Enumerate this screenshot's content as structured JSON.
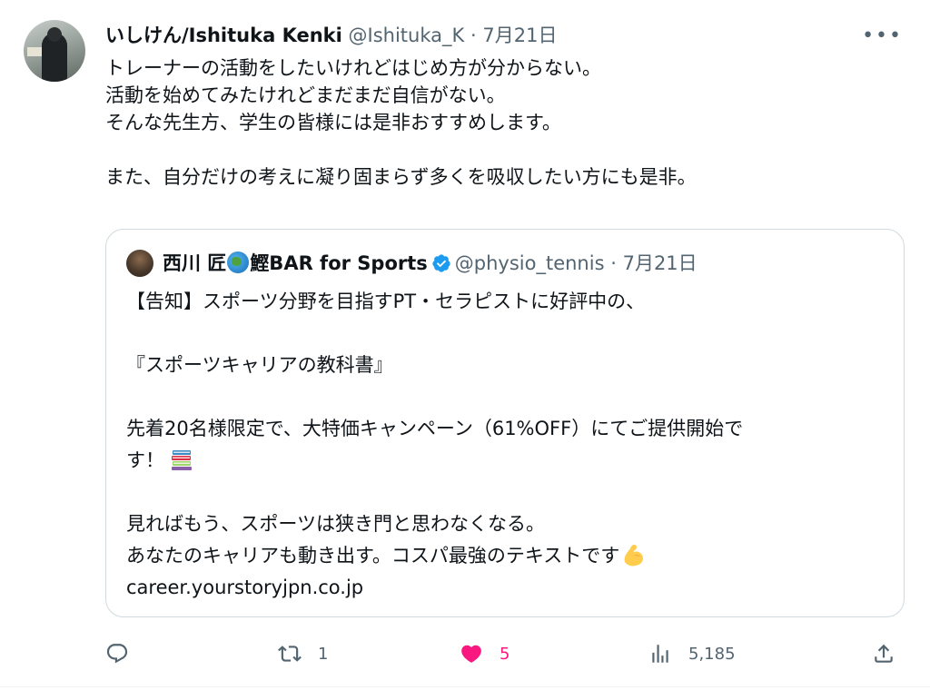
{
  "tweet": {
    "display_name": "いしけん/Ishituka Kenki",
    "handle": "@Ishituka_K",
    "separator": "·",
    "date": "7月21日",
    "more_label": "•••",
    "text_lines": [
      "トレーナーの活動をしたいけれどはじめ方が分からない。",
      "活動を始めてみたけれどまだまだ自信がない。",
      "そんな先生方、学生の皆様には是非おすすめします。",
      "",
      "また、自分だけの考えに凝り固まらず多くを吸収したい方にも是非。"
    ]
  },
  "quote": {
    "name_part1": "西川 匠",
    "name_part2": "鰹BAR for Sports",
    "globe_icon": "globe-icon",
    "verified_icon": "verified-badge-icon",
    "handle": "@physio_tennis",
    "separator": "·",
    "date": "7月21日",
    "text_lines": [
      "【告知】スポーツ分野を目指すPT・セラピストに好評中の、",
      "",
      "『スポーツキャリアの教科書』",
      "",
      "先着20名様限定で、大特価キャンペーン（61%OFF）にてご提供開始で",
      "す！",
      "",
      "見ればもう、スポーツは狭き門と思わなくなる。",
      "あなたのキャリアも動き出す。コスパ最強のテキストです",
      "career.yourstoryjpn.co.jp"
    ],
    "books_emoji_icon": "books-emoji-icon",
    "muscle_emoji_icon": "flexed-biceps-emoji-icon"
  },
  "actions": {
    "reply_count": "",
    "retweet_count": "1",
    "like_count": "5",
    "views_count": "5,185"
  },
  "colors": {
    "text": "#0f1419",
    "secondary": "#536471",
    "like": "#f91880",
    "verified": "#1d9bf0",
    "border": "#cfd9de"
  }
}
